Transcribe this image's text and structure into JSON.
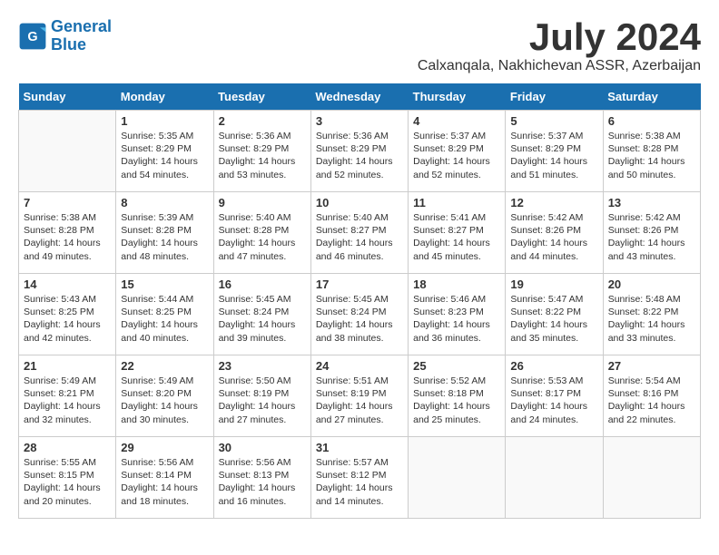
{
  "logo": {
    "line1": "General",
    "line2": "Blue"
  },
  "title": "July 2024",
  "location": "Calxanqala, Nakhichevan ASSR, Azerbaijan",
  "weekdays": [
    "Sunday",
    "Monday",
    "Tuesday",
    "Wednesday",
    "Thursday",
    "Friday",
    "Saturday"
  ],
  "weeks": [
    [
      {
        "day": "",
        "content": ""
      },
      {
        "day": "1",
        "content": "Sunrise: 5:35 AM\nSunset: 8:29 PM\nDaylight: 14 hours\nand 54 minutes."
      },
      {
        "day": "2",
        "content": "Sunrise: 5:36 AM\nSunset: 8:29 PM\nDaylight: 14 hours\nand 53 minutes."
      },
      {
        "day": "3",
        "content": "Sunrise: 5:36 AM\nSunset: 8:29 PM\nDaylight: 14 hours\nand 52 minutes."
      },
      {
        "day": "4",
        "content": "Sunrise: 5:37 AM\nSunset: 8:29 PM\nDaylight: 14 hours\nand 52 minutes."
      },
      {
        "day": "5",
        "content": "Sunrise: 5:37 AM\nSunset: 8:29 PM\nDaylight: 14 hours\nand 51 minutes."
      },
      {
        "day": "6",
        "content": "Sunrise: 5:38 AM\nSunset: 8:28 PM\nDaylight: 14 hours\nand 50 minutes."
      }
    ],
    [
      {
        "day": "7",
        "content": "Sunrise: 5:38 AM\nSunset: 8:28 PM\nDaylight: 14 hours\nand 49 minutes."
      },
      {
        "day": "8",
        "content": "Sunrise: 5:39 AM\nSunset: 8:28 PM\nDaylight: 14 hours\nand 48 minutes."
      },
      {
        "day": "9",
        "content": "Sunrise: 5:40 AM\nSunset: 8:28 PM\nDaylight: 14 hours\nand 47 minutes."
      },
      {
        "day": "10",
        "content": "Sunrise: 5:40 AM\nSunset: 8:27 PM\nDaylight: 14 hours\nand 46 minutes."
      },
      {
        "day": "11",
        "content": "Sunrise: 5:41 AM\nSunset: 8:27 PM\nDaylight: 14 hours\nand 45 minutes."
      },
      {
        "day": "12",
        "content": "Sunrise: 5:42 AM\nSunset: 8:26 PM\nDaylight: 14 hours\nand 44 minutes."
      },
      {
        "day": "13",
        "content": "Sunrise: 5:42 AM\nSunset: 8:26 PM\nDaylight: 14 hours\nand 43 minutes."
      }
    ],
    [
      {
        "day": "14",
        "content": "Sunrise: 5:43 AM\nSunset: 8:25 PM\nDaylight: 14 hours\nand 42 minutes."
      },
      {
        "day": "15",
        "content": "Sunrise: 5:44 AM\nSunset: 8:25 PM\nDaylight: 14 hours\nand 40 minutes."
      },
      {
        "day": "16",
        "content": "Sunrise: 5:45 AM\nSunset: 8:24 PM\nDaylight: 14 hours\nand 39 minutes."
      },
      {
        "day": "17",
        "content": "Sunrise: 5:45 AM\nSunset: 8:24 PM\nDaylight: 14 hours\nand 38 minutes."
      },
      {
        "day": "18",
        "content": "Sunrise: 5:46 AM\nSunset: 8:23 PM\nDaylight: 14 hours\nand 36 minutes."
      },
      {
        "day": "19",
        "content": "Sunrise: 5:47 AM\nSunset: 8:22 PM\nDaylight: 14 hours\nand 35 minutes."
      },
      {
        "day": "20",
        "content": "Sunrise: 5:48 AM\nSunset: 8:22 PM\nDaylight: 14 hours\nand 33 minutes."
      }
    ],
    [
      {
        "day": "21",
        "content": "Sunrise: 5:49 AM\nSunset: 8:21 PM\nDaylight: 14 hours\nand 32 minutes."
      },
      {
        "day": "22",
        "content": "Sunrise: 5:49 AM\nSunset: 8:20 PM\nDaylight: 14 hours\nand 30 minutes."
      },
      {
        "day": "23",
        "content": "Sunrise: 5:50 AM\nSunset: 8:19 PM\nDaylight: 14 hours\nand 27 minutes."
      },
      {
        "day": "24",
        "content": "Sunrise: 5:51 AM\nSunset: 8:19 PM\nDaylight: 14 hours\nand 27 minutes."
      },
      {
        "day": "25",
        "content": "Sunrise: 5:52 AM\nSunset: 8:18 PM\nDaylight: 14 hours\nand 25 minutes."
      },
      {
        "day": "26",
        "content": "Sunrise: 5:53 AM\nSunset: 8:17 PM\nDaylight: 14 hours\nand 24 minutes."
      },
      {
        "day": "27",
        "content": "Sunrise: 5:54 AM\nSunset: 8:16 PM\nDaylight: 14 hours\nand 22 minutes."
      }
    ],
    [
      {
        "day": "28",
        "content": "Sunrise: 5:55 AM\nSunset: 8:15 PM\nDaylight: 14 hours\nand 20 minutes."
      },
      {
        "day": "29",
        "content": "Sunrise: 5:56 AM\nSunset: 8:14 PM\nDaylight: 14 hours\nand 18 minutes."
      },
      {
        "day": "30",
        "content": "Sunrise: 5:56 AM\nSunset: 8:13 PM\nDaylight: 14 hours\nand 16 minutes."
      },
      {
        "day": "31",
        "content": "Sunrise: 5:57 AM\nSunset: 8:12 PM\nDaylight: 14 hours\nand 14 minutes."
      },
      {
        "day": "",
        "content": ""
      },
      {
        "day": "",
        "content": ""
      },
      {
        "day": "",
        "content": ""
      }
    ]
  ]
}
